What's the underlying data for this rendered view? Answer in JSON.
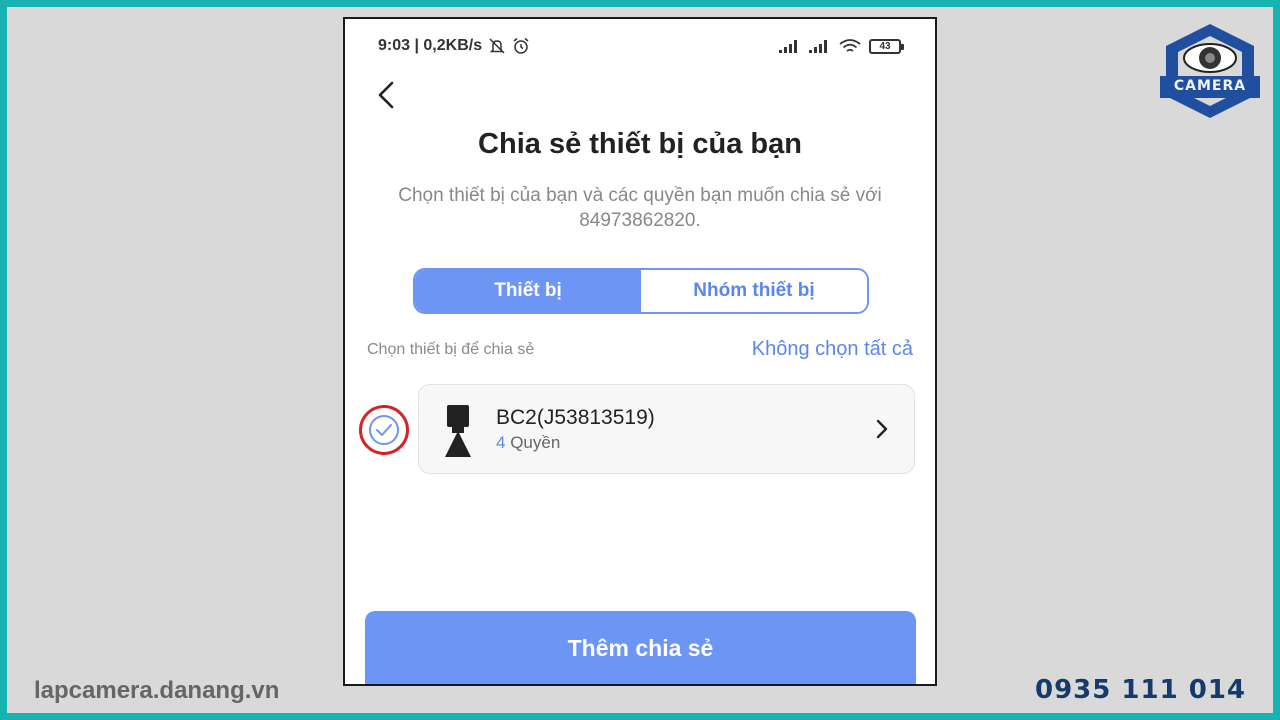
{
  "status_bar": {
    "time_speed": "9:03 | 0,2KB/s",
    "battery": "43",
    "icons": [
      "mute-bell-icon",
      "alarm-icon",
      "signal-icon",
      "signal-icon",
      "wifi-icon",
      "battery-icon"
    ]
  },
  "header": {
    "back_icon": "chevron-left-icon",
    "title": "Chia sẻ thiết bị của bạn",
    "subtitle": "Chọn thiết bị của bạn và các quyền bạn muốn chia sẻ với 84973862820."
  },
  "tabs": [
    {
      "label": "Thiết bị",
      "active": true
    },
    {
      "label": "Nhóm thiết bị",
      "active": false
    }
  ],
  "section": {
    "label": "Chọn thiết bị để chia sẻ",
    "deselect_all": "Không chọn tất cả"
  },
  "devices": [
    {
      "name": "BC2(J53813519)",
      "perm_count": "4",
      "perm_label": "Quyền",
      "selected": true,
      "icon": "camera-device-icon"
    }
  ],
  "actions": {
    "add_share": "Thêm chia sẻ"
  },
  "branding": {
    "logo_text": "CAMERA",
    "website": "lapcamera.danang.vn",
    "hotline": "0935 111 014"
  },
  "colors": {
    "frame": "#17b3b3",
    "accent": "#6c95f5",
    "highlight_ring": "#d6232a",
    "logo_blue": "#1f4f9e"
  }
}
